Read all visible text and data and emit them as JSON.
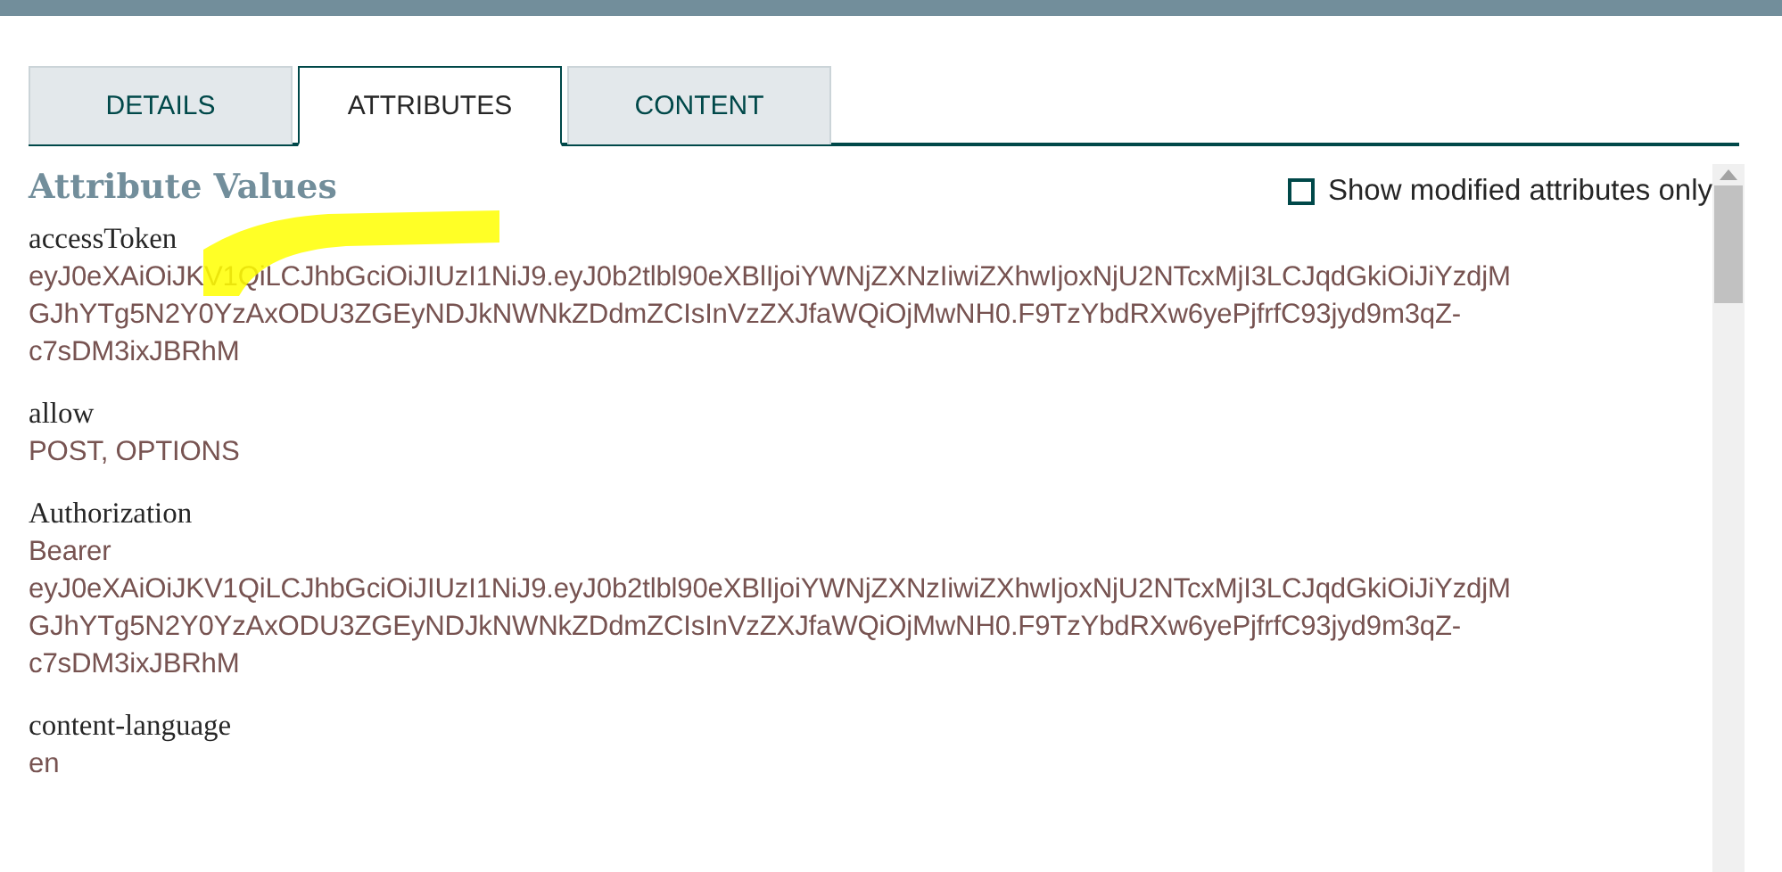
{
  "tabs": [
    {
      "label": "DETAILS",
      "selected": false
    },
    {
      "label": "ATTRIBUTES",
      "selected": true
    },
    {
      "label": "CONTENT",
      "selected": false
    }
  ],
  "heading": "Attribute Values",
  "filter": {
    "label": "Show modified attributes only",
    "checked": false
  },
  "attributes": [
    {
      "name": "accessToken",
      "lines": [
        "eyJ0eXAiOiJKV1QiLCJhbGciOiJIUzI1NiJ9.eyJ0b2tlbl90eXBlIjoiYWNjZXNzIiwiZXhwIjoxNjU2NTcxMjI3LCJqdGkiOiJiYzdjM",
        "GJhYTg5N2Y0YzAxODU3ZGEyNDJkNWNkZDdmZCIsInVzZXJfaWQiOjMwNH0.F9TzYbdRXw6yePjfrfC93jyd9m3qZ-",
        "c7sDM3ixJBRhM"
      ]
    },
    {
      "name": "allow",
      "lines": [
        "POST, OPTIONS"
      ]
    },
    {
      "name": "Authorization",
      "lines": [
        "Bearer",
        "eyJ0eXAiOiJKV1QiLCJhbGciOiJIUzI1NiJ9.eyJ0b2tlbl90eXBlIjoiYWNjZXNzIiwiZXhwIjoxNjU2NTcxMjI3LCJqdGkiOiJiYzdjM",
        "GJhYTg5N2Y0YzAxODU3ZGEyNDJkNWNkZDdmZCIsInVzZXJfaWQiOjMwNH0.F9TzYbdRXw6yePjfrfC93jyd9m3qZ-",
        "c7sDM3ixJBRhM"
      ]
    },
    {
      "name": "content-language",
      "lines": [
        "en"
      ]
    }
  ]
}
